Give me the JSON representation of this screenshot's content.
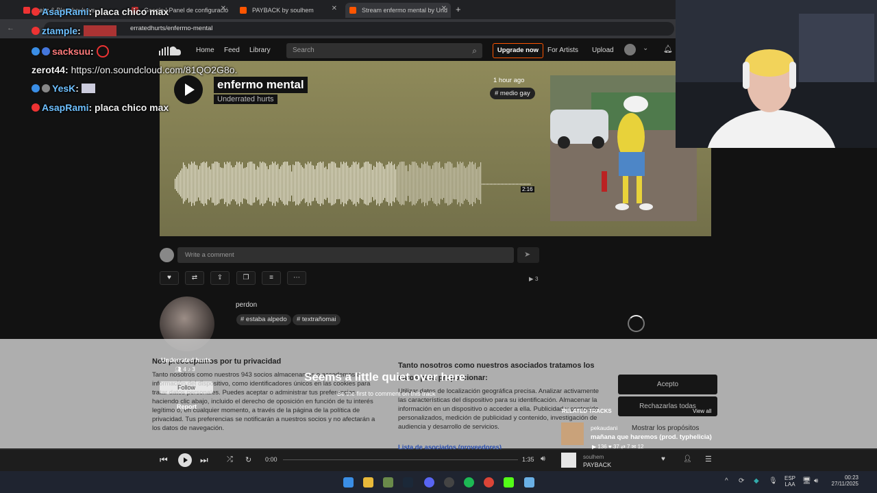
{
  "browser": {
    "tabs": [
      {
        "label": "trakz & Blancheyboys - "
      },
      {
        "label": "Google LPanel de configuració"
      },
      {
        "label": "PAYBACK by soulhem"
      },
      {
        "label": "Stream enfermo mental by Und"
      }
    ],
    "url": "erratedhurts/enfermo-mental"
  },
  "nav": {
    "home": "Home",
    "feed": "Feed",
    "library": "Library",
    "search_placeholder": "Search",
    "upgrade": "Upgrade now",
    "for_artists": "For Artists",
    "upload": "Upload"
  },
  "track": {
    "title": "enfermo mental",
    "artist": "Underrated hurts",
    "time_ago": "1 hour ago",
    "tag": "# medio gay",
    "duration": "2:16",
    "progress": 0.62
  },
  "comment": {
    "placeholder": "Write a comment"
  },
  "stats": {
    "plays": "3"
  },
  "description": {
    "text": "perdon",
    "tags": [
      "# estaba alpedo",
      "# textrañomai"
    ]
  },
  "uploader": {
    "name": "Underrated hurts",
    "followers": "4",
    "tracks": "3",
    "follow": "Follow",
    "report": "Report"
  },
  "empty_comments": {
    "title": "Seems a little quiet over here",
    "subtitle": "Be the first to comment on this track"
  },
  "consent": {
    "left_title": "Nos preocupamos por tu privacidad",
    "left_body": "Tanto nosotros como nuestros 943 socios almacenamos o accedemos a información del dispositivo, como identificadores únicos en las cookies para tratar datos personales. Puedes aceptar o administrar tus preferencias haciendo clic abajo, incluido el derecho de oposición en función de tu interés legítimo o, en cualquier momento, a través de la página de la política de privacidad. Tus preferencias se notificarán a nuestros socios y no afectarán a los datos de navegación.",
    "right_title": "Tanto nosotros como nuestros asociados tratamos los datos para proporcionar:",
    "right_body": "Utilizar datos de localización geográfica precisa. Analizar activamente las características del dispositivo para su identificación. Almacenar la información en un dispositivo o acceder a ella. Publicidad y contenido personalizados, medición de publicidad y contenido, investigación de audiencia y desarrollo de servicios.",
    "partners_link": "Lista de asociados (proveedores)",
    "accept": "Acepto",
    "reject": "Rechazarlas todas",
    "purposes": "Mostrar los propósitos"
  },
  "related": {
    "heading": "RELATED TRACKS",
    "view_all": "View all",
    "artist": "pekaudani",
    "title": "mañana que haremos (prod. typhelicia)",
    "plays": "136",
    "likes": "37",
    "reposts": "7",
    "comments": "12"
  },
  "player": {
    "current": "0:00",
    "total": "1:35",
    "artist": "soulhem",
    "title": "PAYBACK"
  },
  "chat": [
    {
      "user": "AsapRami",
      "msg": "placa chico max"
    },
    {
      "user": "ztample",
      "msg": ""
    },
    {
      "user": "sacksuu",
      "msg": ""
    },
    {
      "user": "zerot44",
      "msg": "https://on.soundcloud.com/81QO2G8o."
    },
    {
      "user": "YesK",
      "msg": ""
    },
    {
      "user": "AsapRami",
      "msg": "placa chico max"
    }
  ],
  "taskbar": {
    "lang": "ESP",
    "region": "LAA",
    "time": "00:23",
    "date": "27/11/2025"
  },
  "colors": {
    "accent": "#ff5500",
    "hero_bg": "#8f8a5a"
  }
}
